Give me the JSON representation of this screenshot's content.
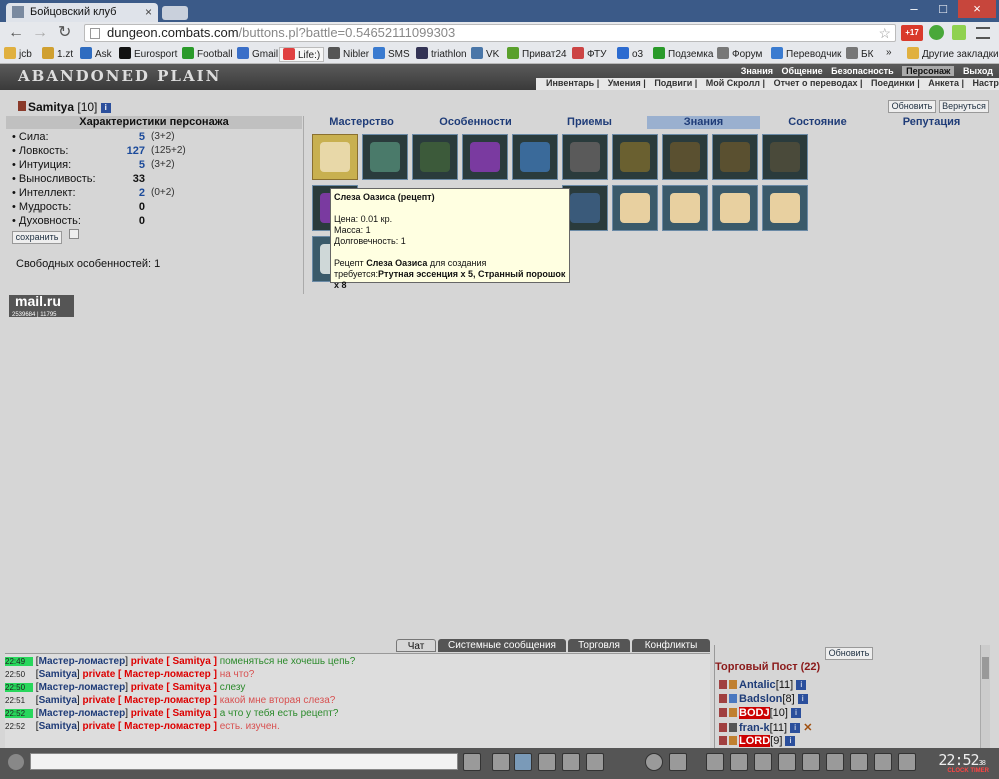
{
  "browser": {
    "tabs": [
      {
        "title": "Бойцовский клуб"
      }
    ],
    "url_host": "dungeon.combats.com",
    "url_path": "/buttons.pl?battle=0.54652111099303",
    "badge": "+17",
    "bookmarks": [
      "jcb",
      "1.zt",
      "Ask",
      "Eurosport",
      "Football",
      "Gmail",
      "Life:)",
      "Nibler",
      "SMS",
      "triathlon",
      "VK",
      "Приват24",
      "ФТУ",
      "o3",
      "Подземка",
      "Форум",
      "Переводчик",
      "БК",
      "»",
      "Другие закладки"
    ]
  },
  "game": {
    "logo": "ABANDONED PLAIN",
    "nav_top": [
      "Знания",
      "Общение",
      "Безопасность",
      "Персонаж",
      "Выход"
    ],
    "nav_sub": [
      "Инвентарь",
      "Умения",
      "Подвиги",
      "Мой Скролл",
      "Отчет о переводах",
      "Поединки",
      "Анкета",
      "Настройки"
    ],
    "refresh_label": "Обновить",
    "back_label": "Вернуться"
  },
  "character": {
    "name": "Samitya",
    "level": "[10]",
    "stats_title": "Характеристики персонажа",
    "stats": [
      {
        "label": "• Сила:",
        "value": "5",
        "bonus": "(3+2)"
      },
      {
        "label": "• Ловкость:",
        "value": "127",
        "bonus": "(125+2)"
      },
      {
        "label": "• Интуиция:",
        "value": "5",
        "bonus": "(3+2)"
      },
      {
        "label": "• Выносливость:",
        "value": "33",
        "bonus": ""
      },
      {
        "label": "• Интеллект:",
        "value": "2",
        "bonus": "(0+2)"
      },
      {
        "label": "• Мудрость:",
        "value": "0",
        "bonus": ""
      },
      {
        "label": "• Духовность:",
        "value": "0",
        "bonus": ""
      }
    ],
    "save_label": "сохранить",
    "free_features": "Свободных особенностей: 1"
  },
  "skill_tabs": [
    "Мастерство",
    "Особенности",
    "Приемы",
    "Знания",
    "Состояние",
    "Репутация"
  ],
  "active_tab": "Знания",
  "tooltip": {
    "title": "Слеза Оазиса (рецепт)",
    "price": "Цена: 0.01 кр.",
    "mass": "Масса: 1",
    "durability": "Долговечность: 1",
    "recipe_prefix": "Рецепт",
    "recipe_item": "Слеза Оазиса",
    "recipe_mid": "для создания",
    "requires": "требуется:",
    "ingredients": "Ртутная эссенция x 5, Странный порошок x 8"
  },
  "counter": {
    "brand": "mail.ru",
    "hits": "2539684 | 11795"
  },
  "chat": {
    "tabs": [
      "Чат",
      "Системные сообщения",
      "Торговля",
      "Конфликты"
    ],
    "lines": [
      {
        "time": "22:49",
        "hl": true,
        "from": "Мастер-ломастер",
        "private": "private [ Samitya ]",
        "msg": "поменяться не хочешь цепь?",
        "color": "green"
      },
      {
        "time": "22:50",
        "hl": false,
        "from": "Samitya",
        "private": "private [ Мастер-ломастер ]",
        "msg": "на что?",
        "color": "red"
      },
      {
        "time": "22:50",
        "hl": true,
        "from": "Мастер-ломастер",
        "private": "private [ Samitya ]",
        "msg": "слезу",
        "color": "green"
      },
      {
        "time": "22:51",
        "hl": false,
        "from": "Samitya",
        "private": "private [ Мастер-ломастер ]",
        "msg": "какой мне вторая слеза?",
        "color": "red"
      },
      {
        "time": "22:52",
        "hl": true,
        "from": "Мастер-ломастер",
        "private": "private [ Samitya ]",
        "msg": "а что у тебя есть рецепт?",
        "color": "green"
      },
      {
        "time": "22:52",
        "hl": false,
        "from": "Samitya",
        "private": "private [ Мастер-ломастер ]",
        "msg": "есть. изучен.",
        "color": "red"
      }
    ]
  },
  "trade_post": {
    "refresh_label": "Обновить",
    "title": "Торговый Пост (22)",
    "players": [
      {
        "name": "Antalic",
        "level": "[11]",
        "red": false
      },
      {
        "name": "Badslon",
        "level": "[8]",
        "red": false
      },
      {
        "name": "BODJ",
        "level": "[10]",
        "red": true
      },
      {
        "name": "fran-k",
        "level": "[11]",
        "red": false
      },
      {
        "name": "LORD",
        "level": "[9]",
        "red": true
      }
    ]
  },
  "clock": {
    "time": "22:52",
    "seconds": "38",
    "label": "CLOCK TIMER"
  }
}
